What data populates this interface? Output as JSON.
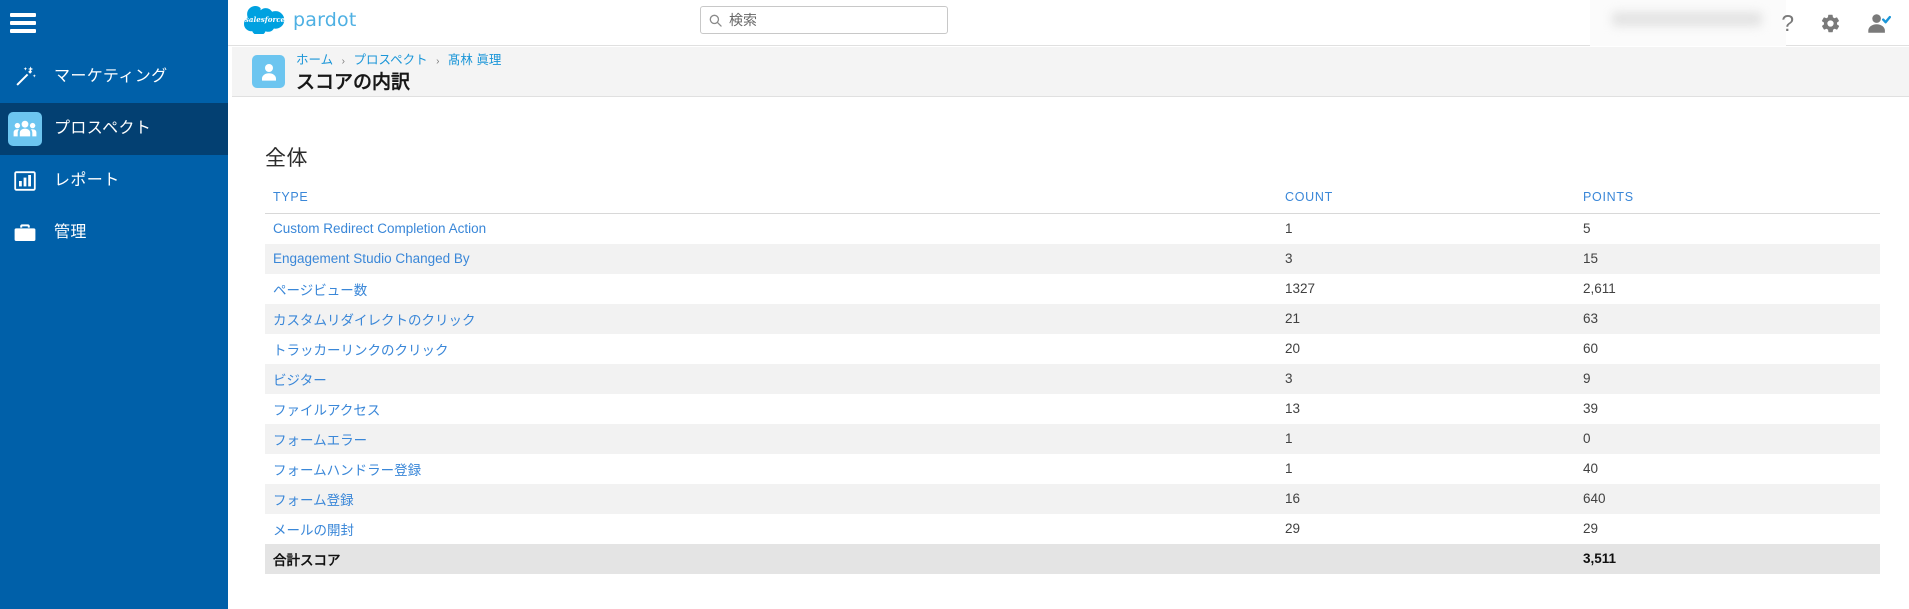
{
  "sidebar": {
    "menu_icon": "hamburger-icon",
    "items": [
      {
        "label": "マーケティング",
        "icon": "magic-wand-icon",
        "active": false
      },
      {
        "label": "プロスペクト",
        "icon": "people-group-icon",
        "active": true
      },
      {
        "label": "レポート",
        "icon": "bar-chart-icon",
        "active": false
      },
      {
        "label": "管理",
        "icon": "briefcase-icon",
        "active": false
      }
    ]
  },
  "topbar": {
    "logo_brand": "salesforce",
    "logo_product": "pardot",
    "search": {
      "placeholder": "検索",
      "value": "",
      "icon": "search-icon"
    },
    "icons": [
      {
        "name": "help-icon",
        "glyph": "?"
      },
      {
        "name": "gear-icon",
        "glyph": "gear"
      },
      {
        "name": "user-avatar-icon",
        "glyph": "user-check"
      }
    ]
  },
  "page_header": {
    "avatar_icon": "person-avatar-icon",
    "breadcrumb": [
      {
        "label": "ホーム"
      },
      {
        "label": "プロスペクト"
      },
      {
        "label": "髙林 眞理"
      }
    ],
    "breadcrumb_separator": "›",
    "title": "スコアの内訳"
  },
  "main": {
    "section_title": "全体",
    "table": {
      "columns": [
        "TYPE",
        "COUNT",
        "POINTS"
      ],
      "rows": [
        {
          "type": "Custom Redirect Completion Action",
          "count": "1",
          "points": "5"
        },
        {
          "type": "Engagement Studio Changed By",
          "count": "3",
          "points": "15"
        },
        {
          "type": "ページビュー数",
          "count": "1327",
          "points": "2,611"
        },
        {
          "type": "カスタムリダイレクトのクリック",
          "count": "21",
          "points": "63"
        },
        {
          "type": "トラッカーリンクのクリック",
          "count": "20",
          "points": "60"
        },
        {
          "type": "ビジター",
          "count": "3",
          "points": "9"
        },
        {
          "type": "ファイルアクセス",
          "count": "13",
          "points": "39"
        },
        {
          "type": "フォームエラー",
          "count": "1",
          "points": "0"
        },
        {
          "type": "フォームハンドラー登録",
          "count": "1",
          "points": "40"
        },
        {
          "type": "フォーム登録",
          "count": "16",
          "points": "640"
        },
        {
          "type": "メールの開封",
          "count": "29",
          "points": "29"
        }
      ],
      "total_row": {
        "type": "合計スコア",
        "count": "",
        "points": "3,511"
      }
    }
  },
  "colors": {
    "sidebar_blue": "#0060a9",
    "sidebar_active": "#034072",
    "accent_light_blue": "#6cc5f0",
    "link_blue": "#3a87d8",
    "breadcrumb_blue": "#1b96d8",
    "header_bg": "#f4f4f4",
    "row_alt": "#f2f2f2",
    "total_row_bg": "#e4e4e4"
  }
}
